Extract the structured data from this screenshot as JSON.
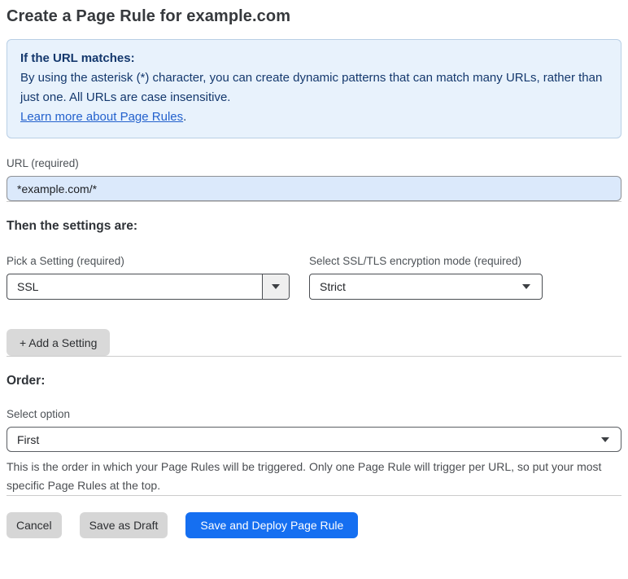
{
  "page": {
    "title": "Create a Page Rule for example.com"
  },
  "info_box": {
    "heading": "If the URL matches:",
    "body": "By using the asterisk (*) character, you can create dynamic patterns that can match many URLs, rather than just one. All URLs are case insensitive.",
    "link_label": "Learn more about Page Rules",
    "link_suffix": "."
  },
  "url_field": {
    "label": "URL (required)",
    "value": "*example.com/*"
  },
  "settings_section": {
    "heading": "Then the settings are:",
    "setting_select": {
      "label": "Pick a Setting (required)",
      "value": "SSL"
    },
    "mode_select": {
      "label": "Select SSL/TLS encryption mode (required)",
      "value": "Strict"
    },
    "add_setting_label": "+ Add a Setting"
  },
  "order_section": {
    "heading": "Order:",
    "select_label": "Select option",
    "select_value": "First",
    "help_text": "This is the order in which your Page Rules will be triggered. Only one Page Rule will trigger per URL, so put your most specific Page Rules at the top."
  },
  "footer": {
    "cancel_label": "Cancel",
    "save_draft_label": "Save as Draft",
    "save_deploy_label": "Save and Deploy Page Rule"
  },
  "colors": {
    "accent_blue": "#156ff1",
    "info_background": "#e8f2fc",
    "info_border": "#b9cfe5",
    "info_text": "#14386d",
    "link_blue": "#2361cd",
    "url_input_background": "#dbe9fb"
  }
}
